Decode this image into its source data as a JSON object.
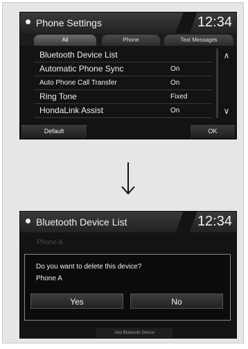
{
  "screen1": {
    "title": "Phone Settings",
    "clock": "12:34",
    "tabs": [
      "All",
      "Phone",
      "Text Messages"
    ],
    "rows": [
      {
        "label": "Bluetooth Device List",
        "value": ""
      },
      {
        "label": "Automatic Phone Sync",
        "value": "On"
      },
      {
        "label": "Auto Phone Call Transfer",
        "value": "On"
      },
      {
        "label": "Ring Tone",
        "value": "Fixed"
      },
      {
        "label": "HondaLink Assist",
        "value": "On"
      }
    ],
    "buttons": {
      "default": "Default",
      "ok": "OK"
    }
  },
  "arrow": {
    "icon": "down-arrow"
  },
  "screen2": {
    "title": "Bluetooth Device List",
    "clock": "12:34",
    "device_dim": "Phone A",
    "dialog": {
      "question": "Do you want to delete this device?",
      "device": "Phone A",
      "yes": "Yes",
      "no": "No"
    },
    "add_button": "Add Bluetooth Device"
  }
}
